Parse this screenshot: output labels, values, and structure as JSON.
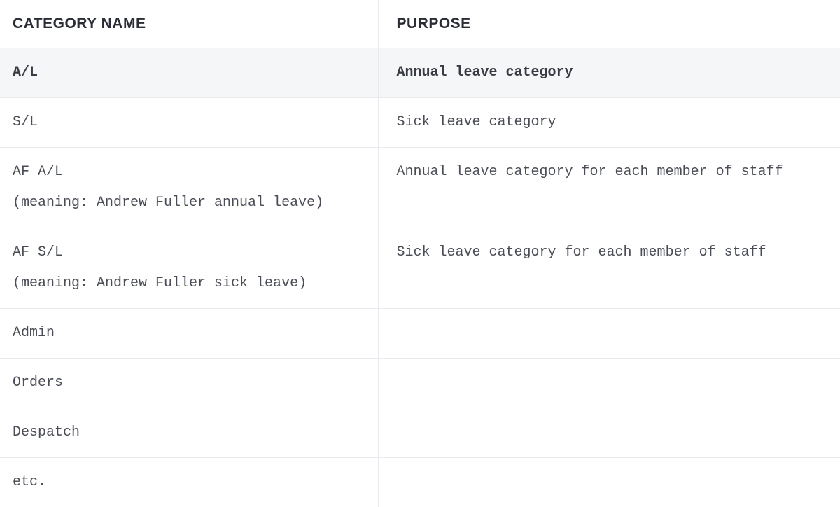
{
  "table": {
    "headers": {
      "col1": "CATEGORY NAME",
      "col2": "PURPOSE"
    },
    "rows": [
      {
        "name": "A/L",
        "note": "",
        "purpose": "Annual leave category",
        "highlight": true
      },
      {
        "name": "S/L",
        "note": "",
        "purpose": "Sick leave category",
        "highlight": false
      },
      {
        "name": "AF A/L",
        "note": "(meaning: Andrew Fuller annual leave)",
        "purpose": "Annual leave category for each member of staff",
        "highlight": false
      },
      {
        "name": "AF S/L",
        "note": "(meaning: Andrew Fuller sick leave)",
        "purpose": "Sick leave category for each member of staff",
        "highlight": false
      },
      {
        "name": "Admin",
        "note": "",
        "purpose": "",
        "highlight": false
      },
      {
        "name": "Orders",
        "note": "",
        "purpose": "",
        "highlight": false
      },
      {
        "name": "Despatch",
        "note": "",
        "purpose": "",
        "highlight": false
      },
      {
        "name": "etc.",
        "note": "",
        "purpose": "",
        "highlight": false
      }
    ]
  }
}
